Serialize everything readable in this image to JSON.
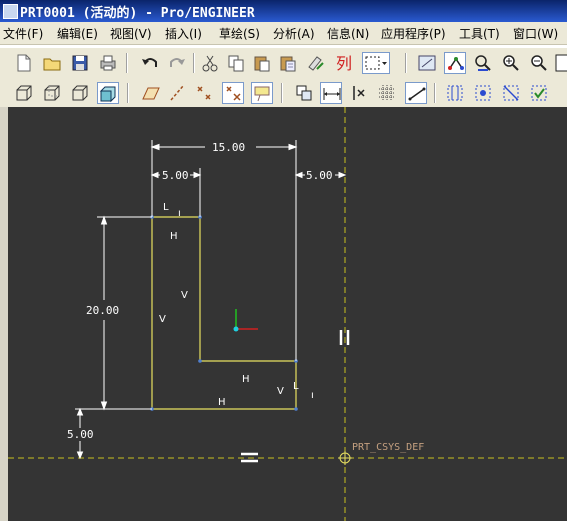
{
  "window": {
    "title": "PRT0001 (活动的) - Pro/ENGINEER"
  },
  "menu": [
    {
      "label": "文件(F)"
    },
    {
      "label": "编辑(E)"
    },
    {
      "label": "视图(V)"
    },
    {
      "label": "插入(I)"
    },
    {
      "label": "草绘(S)"
    },
    {
      "label": "分析(A)"
    },
    {
      "label": "信息(N)"
    },
    {
      "label": "应用程序(P)"
    },
    {
      "label": "工具(T)"
    },
    {
      "label": "窗口(W)"
    }
  ],
  "toolbar": {
    "relations_glyph": "列"
  },
  "sketch": {
    "dimensions": {
      "overall_width": "15.00",
      "left_thickness": "5.00",
      "right_offset": "5.00",
      "height": "20.00",
      "bottom_offset": "5.00"
    },
    "constraints": {
      "h1": "H",
      "h2": "H",
      "h3": "H",
      "v1": "V",
      "v2": "V",
      "v3": "V",
      "l1": "L",
      "l2": "L"
    },
    "csys_label": "PRT_CSYS_DEF"
  },
  "colors": {
    "canvas_bg": "#343434",
    "sketch_geometry": "#e8e060",
    "dimension": "#ffffff",
    "centerline": "#c8c020",
    "csys_label": "#c4a080"
  }
}
